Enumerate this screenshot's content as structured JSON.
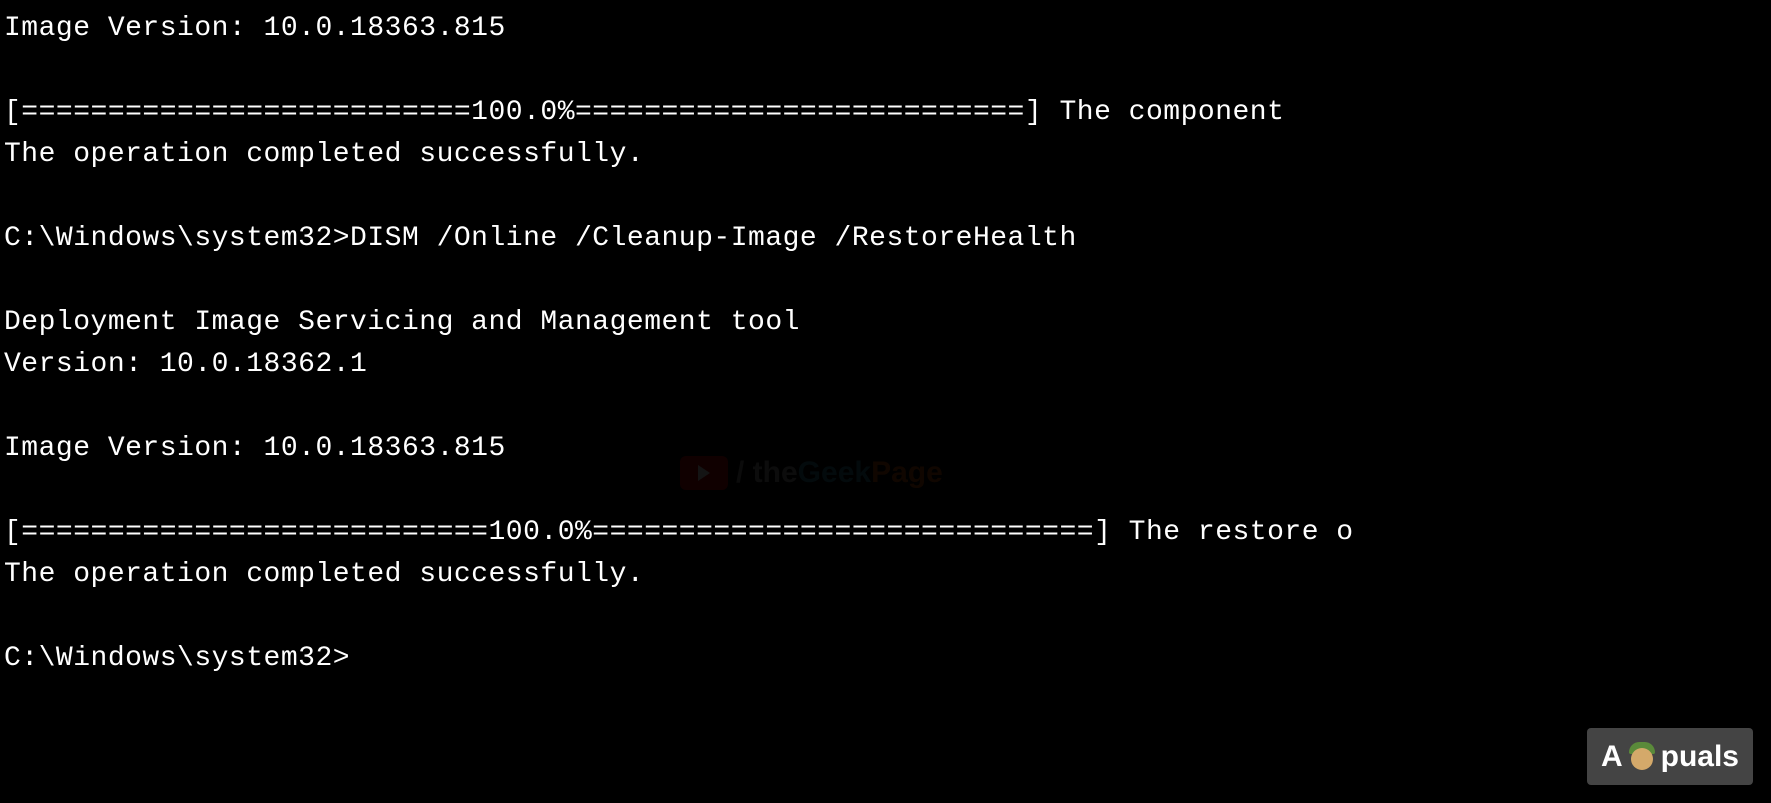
{
  "terminal": {
    "lines": [
      "Image Version: 10.0.18363.815",
      "",
      "[==========================100.0%==========================] The component",
      "The operation completed successfully.",
      "",
      "C:\\Windows\\system32>DISM /Online /Cleanup-Image /RestoreHealth",
      "",
      "Deployment Image Servicing and Management tool",
      "Version: 10.0.18362.1",
      "",
      "Image Version: 10.0.18363.815",
      "",
      "[===========================100.0%=============================] The restore o",
      "The operation completed successfully.",
      "",
      "C:\\Windows\\system32>"
    ]
  },
  "watermark_center": {
    "slash": "/ ",
    "the": "the",
    "geek": "Geek",
    "page": "Page"
  },
  "watermark_corner": {
    "prefix": "A",
    "suffix": "puals"
  }
}
